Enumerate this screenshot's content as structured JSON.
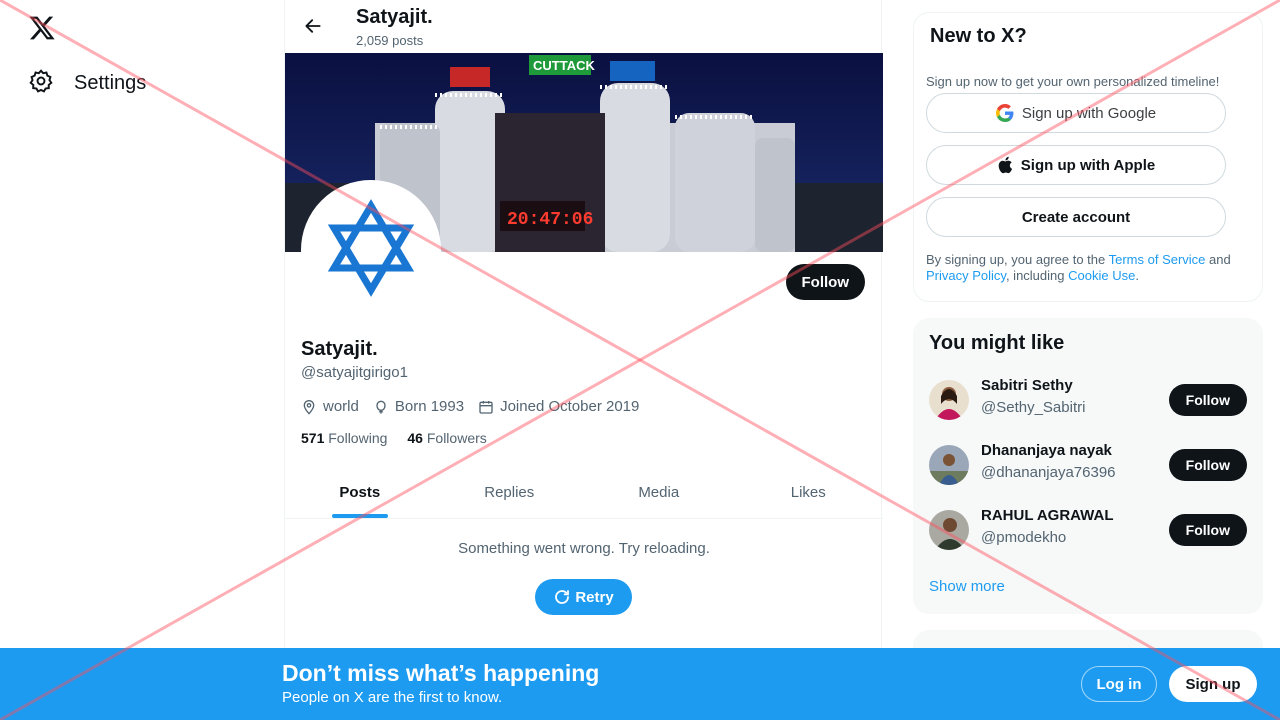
{
  "nav": {
    "settings_label": "Settings"
  },
  "topbar": {
    "name": "Satyajit.",
    "posts_count": "2,059 posts"
  },
  "banner": {
    "sign_text": "CUTTACK",
    "clock_text": "20:47:06"
  },
  "profile": {
    "name": "Satyajit.",
    "handle": "@satyajitgirigo1",
    "follow_label": "Follow",
    "location": "world",
    "born": "Born 1993",
    "joined": "Joined October 2019",
    "following_count": "571",
    "following_label": "Following",
    "followers_count": "46",
    "followers_label": "Followers"
  },
  "tabs": [
    "Posts",
    "Replies",
    "Media",
    "Likes"
  ],
  "error": {
    "message": "Something went wrong. Try reloading.",
    "retry_label": "Retry"
  },
  "newto": {
    "title": "New to X?",
    "subtitle": "Sign up now to get your own personalized timeline!",
    "google_label": "Sign up with Google",
    "apple_label": "Sign up with Apple",
    "create_label": "Create account",
    "terms_prefix": "By signing up, you agree to the ",
    "terms_link": "Terms of Service",
    "terms_and": " and ",
    "privacy_link": "Privacy Policy",
    "terms_including": ", including ",
    "cookie_link": "Cookie Use",
    "terms_end": "."
  },
  "you_might_like": {
    "title": "You might like",
    "items": [
      {
        "name": "Sabitri Sethy",
        "handle": "@Sethy_Sabitri",
        "follow_label": "Follow"
      },
      {
        "name": "Dhananjaya nayak",
        "handle": "@dhananjaya76396",
        "follow_label": "Follow"
      },
      {
        "name": "RAHUL AGRAWAL",
        "handle": "@pmodekho",
        "follow_label": "Follow"
      }
    ],
    "show_more": "Show more"
  },
  "bottom_bar": {
    "title": "Don’t miss what’s happening",
    "subtitle": "People on X are the first to know.",
    "login_label": "Log in",
    "signup_label": "Sign up"
  },
  "colors": {
    "accent": "#1d9bf0",
    "text": "#0f1419",
    "muted": "#536471",
    "overlay": "#ff4d5a"
  }
}
